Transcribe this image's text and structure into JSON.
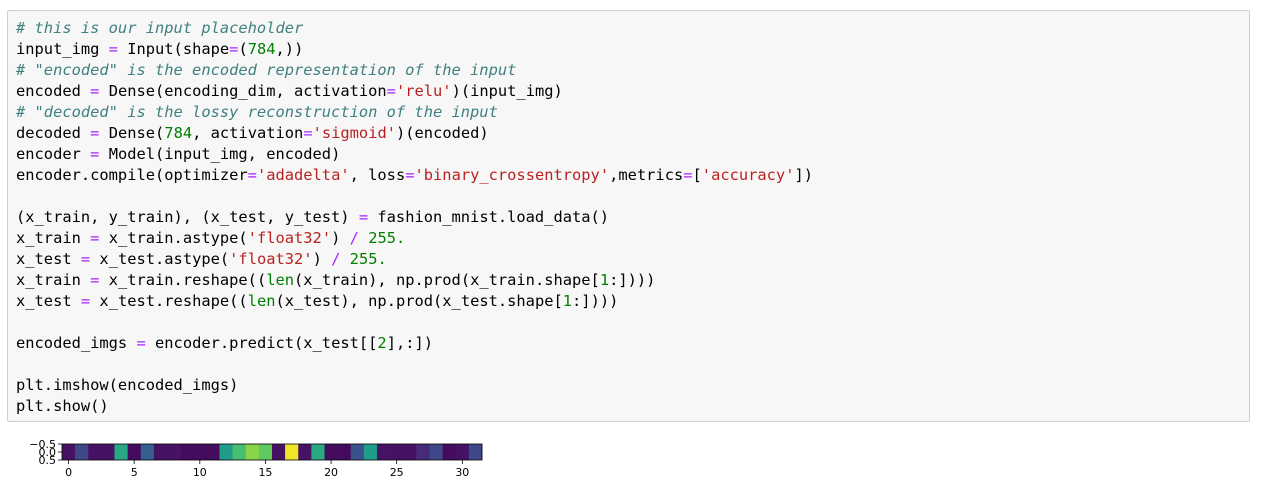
{
  "code_cell": {
    "lines": [
      [
        {
          "t": "comment",
          "v": "# this is our input placeholder"
        }
      ],
      [
        {
          "t": "plain",
          "v": "input_img "
        },
        {
          "t": "op",
          "v": "="
        },
        {
          "t": "plain",
          "v": " Input(shape"
        },
        {
          "t": "op",
          "v": "="
        },
        {
          "t": "plain",
          "v": "("
        },
        {
          "t": "number",
          "v": "784"
        },
        {
          "t": "plain",
          "v": ",))"
        }
      ],
      [
        {
          "t": "comment",
          "v": "# \"encoded\" is the encoded representation of the input"
        }
      ],
      [
        {
          "t": "plain",
          "v": "encoded "
        },
        {
          "t": "op",
          "v": "="
        },
        {
          "t": "plain",
          "v": " Dense(encoding_dim, activation"
        },
        {
          "t": "op",
          "v": "="
        },
        {
          "t": "string",
          "v": "'relu'"
        },
        {
          "t": "plain",
          "v": ")(input_img)"
        }
      ],
      [
        {
          "t": "comment",
          "v": "# \"decoded\" is the lossy reconstruction of the input"
        }
      ],
      [
        {
          "t": "plain",
          "v": "decoded "
        },
        {
          "t": "op",
          "v": "="
        },
        {
          "t": "plain",
          "v": " Dense("
        },
        {
          "t": "number",
          "v": "784"
        },
        {
          "t": "plain",
          "v": ", activation"
        },
        {
          "t": "op",
          "v": "="
        },
        {
          "t": "string",
          "v": "'sigmoid'"
        },
        {
          "t": "plain",
          "v": ")(encoded)"
        }
      ],
      [
        {
          "t": "plain",
          "v": "encoder "
        },
        {
          "t": "op",
          "v": "="
        },
        {
          "t": "plain",
          "v": " Model(input_img, encoded)"
        }
      ],
      [
        {
          "t": "plain",
          "v": "encoder.compile(optimizer"
        },
        {
          "t": "op",
          "v": "="
        },
        {
          "t": "string",
          "v": "'adadelta'"
        },
        {
          "t": "plain",
          "v": ", loss"
        },
        {
          "t": "op",
          "v": "="
        },
        {
          "t": "string",
          "v": "'binary_crossentropy'"
        },
        {
          "t": "plain",
          "v": ",metrics"
        },
        {
          "t": "op",
          "v": "="
        },
        {
          "t": "plain",
          "v": "["
        },
        {
          "t": "string",
          "v": "'accuracy'"
        },
        {
          "t": "plain",
          "v": "])"
        }
      ],
      [],
      [
        {
          "t": "plain",
          "v": "(x_train, y_train), (x_test, y_test) "
        },
        {
          "t": "op",
          "v": "="
        },
        {
          "t": "plain",
          "v": " fashion_mnist.load_data()"
        }
      ],
      [
        {
          "t": "plain",
          "v": "x_train "
        },
        {
          "t": "op",
          "v": "="
        },
        {
          "t": "plain",
          "v": " x_train.astype("
        },
        {
          "t": "string",
          "v": "'float32'"
        },
        {
          "t": "plain",
          "v": ") "
        },
        {
          "t": "op",
          "v": "/"
        },
        {
          "t": "plain",
          "v": " "
        },
        {
          "t": "number",
          "v": "255."
        }
      ],
      [
        {
          "t": "plain",
          "v": "x_test "
        },
        {
          "t": "op",
          "v": "="
        },
        {
          "t": "plain",
          "v": " x_test.astype("
        },
        {
          "t": "string",
          "v": "'float32'"
        },
        {
          "t": "plain",
          "v": ") "
        },
        {
          "t": "op",
          "v": "/"
        },
        {
          "t": "plain",
          "v": " "
        },
        {
          "t": "number",
          "v": "255."
        }
      ],
      [
        {
          "t": "plain",
          "v": "x_train "
        },
        {
          "t": "op",
          "v": "="
        },
        {
          "t": "plain",
          "v": " x_train.reshape(("
        },
        {
          "t": "builtin",
          "v": "len"
        },
        {
          "t": "plain",
          "v": "(x_train), np.prod(x_train.shape["
        },
        {
          "t": "number",
          "v": "1"
        },
        {
          "t": "plain",
          "v": ":])))"
        }
      ],
      [
        {
          "t": "plain",
          "v": "x_test "
        },
        {
          "t": "op",
          "v": "="
        },
        {
          "t": "plain",
          "v": " x_test.reshape(("
        },
        {
          "t": "builtin",
          "v": "len"
        },
        {
          "t": "plain",
          "v": "(x_test), np.prod(x_test.shape["
        },
        {
          "t": "number",
          "v": "1"
        },
        {
          "t": "plain",
          "v": ":])))"
        }
      ],
      [],
      [
        {
          "t": "plain",
          "v": "encoded_imgs "
        },
        {
          "t": "op",
          "v": "="
        },
        {
          "t": "plain",
          "v": " encoder.predict(x_test[["
        },
        {
          "t": "number",
          "v": "2"
        },
        {
          "t": "plain",
          "v": "],:])"
        }
      ],
      [],
      [
        {
          "t": "plain",
          "v": "plt.imshow(encoded_imgs)"
        }
      ],
      [
        {
          "t": "plain",
          "v": "plt.show()"
        }
      ]
    ]
  },
  "chart_data": {
    "type": "heatmap",
    "title": "",
    "xlabel": "",
    "ylabel": "",
    "colormap": "viridis",
    "xlim": [
      -0.5,
      31.5
    ],
    "ylim": [
      0.5,
      -0.5
    ],
    "x_ticks": [
      0,
      5,
      10,
      15,
      20,
      25,
      30
    ],
    "x_tick_labels": [
      "0",
      "5",
      "10",
      "15",
      "20",
      "25",
      "30"
    ],
    "y_ticks": [
      -0.5,
      0.0,
      0.5
    ],
    "y_tick_labels": [
      "−0.5",
      "0.0",
      "0.5"
    ],
    "rows": [
      [
        0.05,
        0.22,
        0.05,
        0.05,
        0.6,
        0.03,
        0.3,
        0.05,
        0.05,
        0.03,
        0.03,
        0.03,
        0.55,
        0.7,
        0.82,
        0.75,
        0.05,
        0.98,
        0.05,
        0.6,
        0.03,
        0.03,
        0.25,
        0.55,
        0.05,
        0.05,
        0.05,
        0.12,
        0.22,
        0.03,
        0.05,
        0.22
      ]
    ],
    "colors": {
      "viridis": [
        "#440154",
        "#482878",
        "#3e4989",
        "#31688e",
        "#26828e",
        "#1f9e89",
        "#35b779",
        "#6ece58",
        "#b5de2b",
        "#fde725"
      ]
    }
  }
}
